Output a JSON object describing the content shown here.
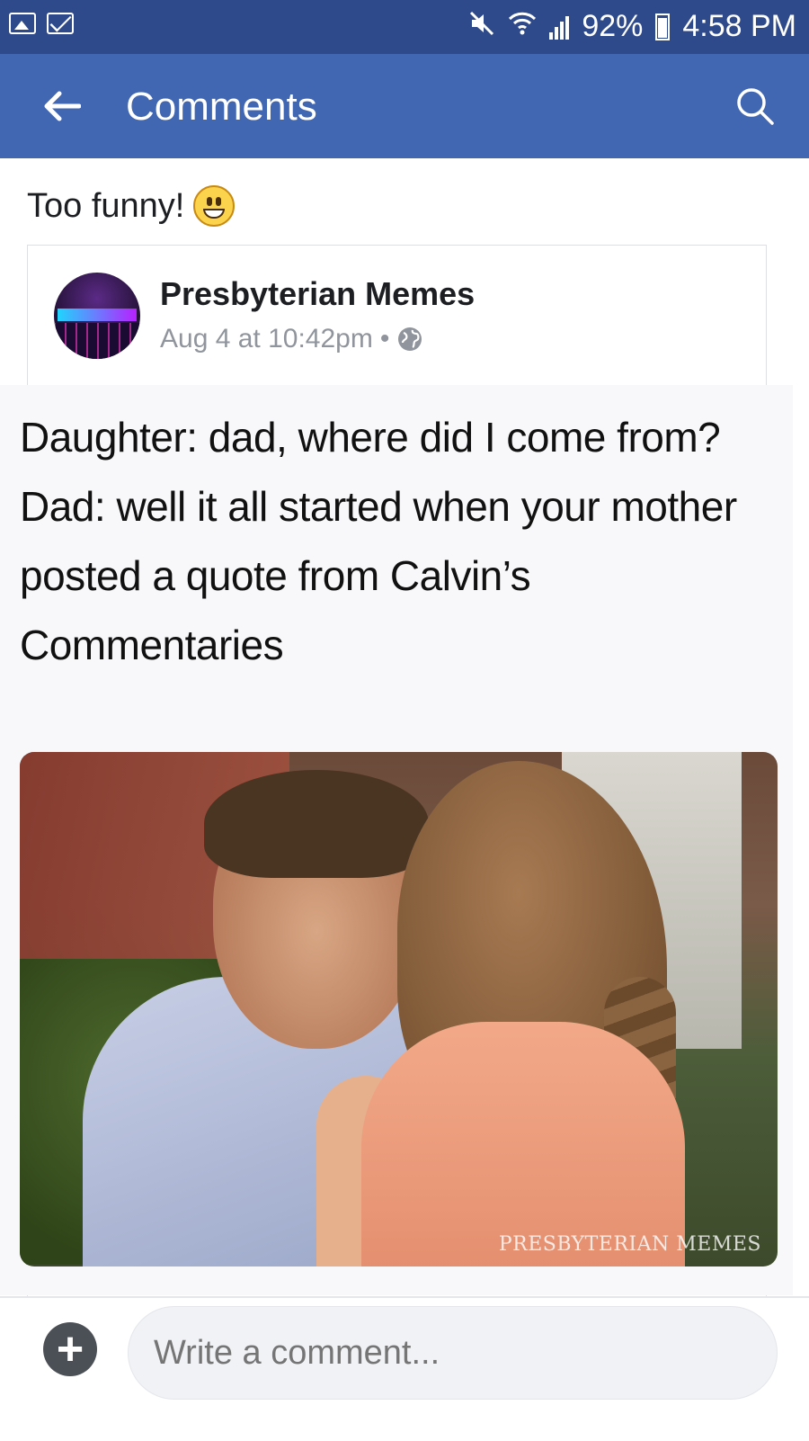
{
  "status_bar": {
    "battery": "92%",
    "time": "4:58 PM"
  },
  "app_bar": {
    "title": "Comments"
  },
  "comment": {
    "text": "Too funny!"
  },
  "shared_post": {
    "author": "Presbyterian Memes",
    "timestamp": "Aug 4 at 10:42pm",
    "separator": "•",
    "meme_lines": [
      "Daughter: dad, where did I come from?",
      "Dad: well it all started when your mother posted a quote from Calvin’s Commentaries"
    ],
    "photo_watermark": "PRESBYTERIAN MEMES"
  },
  "composer": {
    "add_label": "+",
    "placeholder": "Write a comment..."
  },
  "colors": {
    "status_bar": "#2f4a8a",
    "app_bar": "#4267b2",
    "meta_text": "#90949c"
  }
}
